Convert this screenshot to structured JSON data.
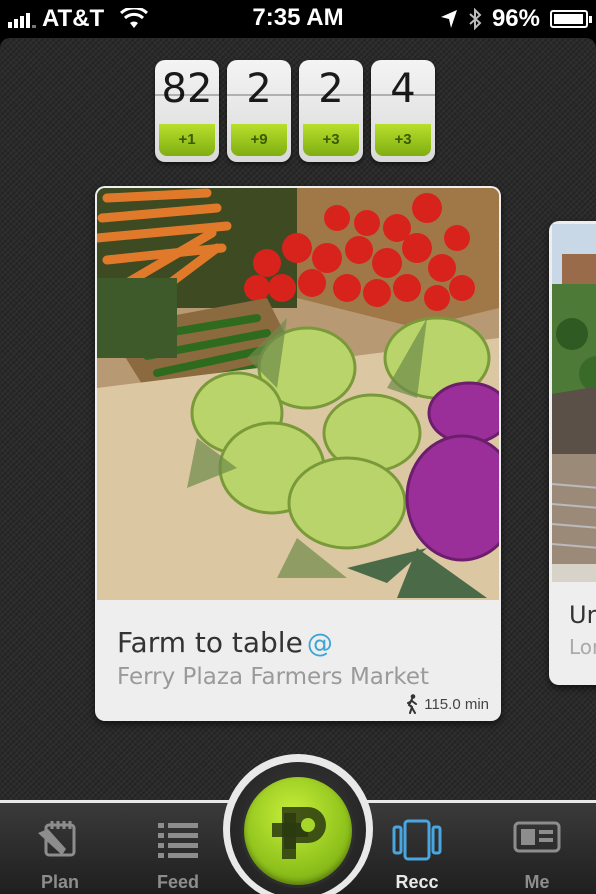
{
  "status_bar": {
    "carrier": "AT&T",
    "time": "7:35 AM",
    "battery": "96%",
    "battery_level": 0.96
  },
  "counters": [
    {
      "value": "82",
      "delta": "+1"
    },
    {
      "value": "2",
      "delta": "+9"
    },
    {
      "value": "2",
      "delta": "+3"
    },
    {
      "value": "4",
      "delta": "+3"
    }
  ],
  "card": {
    "title": "Farm to table",
    "at_symbol": "@",
    "subtitle": "Ferry Plaza Farmers Market",
    "distance": "115.0 min"
  },
  "next_card": {
    "title": "Ur",
    "subtitle": "Lor"
  },
  "tabbar": {
    "plan": "Plan",
    "feed": "Feed",
    "recc": "Recc",
    "me": "Me",
    "active_color": "#e9e9e9",
    "inactive_color": "#8d8d8d",
    "accent_color": "#a6d62a"
  }
}
